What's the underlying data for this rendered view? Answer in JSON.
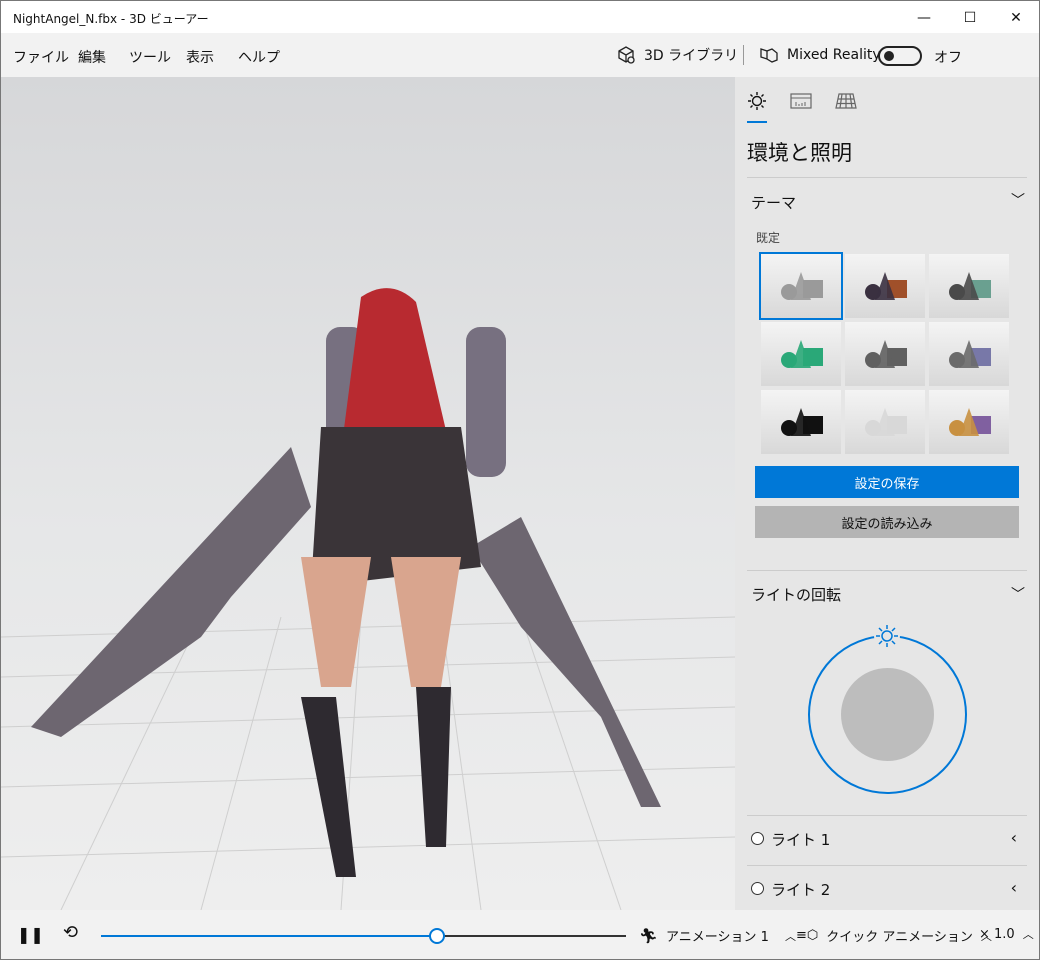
{
  "window": {
    "title": "NightAngel_N.fbx - 3D ビューアー",
    "minimize": "—",
    "maximize": "☐",
    "close": "✕"
  },
  "menu": [
    "ファイル",
    "編集",
    "ツール",
    "表示",
    "ヘルプ"
  ],
  "toolbar": {
    "library_label": "3D ライブラリ",
    "mixed_reality_label": "Mixed Reality",
    "toggle_state": "オフ",
    "toggle_on": false
  },
  "panel": {
    "tabs": [
      {
        "icon": "sun-icon",
        "active": true
      },
      {
        "icon": "stats-icon",
        "active": false
      },
      {
        "icon": "grid-icon",
        "active": false
      }
    ],
    "heading": "環境と照明",
    "theme": {
      "label": "テーマ",
      "default_label": "既定",
      "selected_index": 0,
      "swatches": [
        [
          "#9a9a9a",
          "#9a9a9a"
        ],
        [
          "#3a3040",
          "#a0502a"
        ],
        [
          "#4a4a4a",
          "#6aa090"
        ],
        [
          "#2aa878",
          "#2aa878"
        ],
        [
          "#606060",
          "#606060"
        ],
        [
          "#6a6a6a",
          "#7878a8"
        ],
        [
          "#111111",
          "#111111"
        ],
        [
          "#d8d8d8",
          "#d8d8d8"
        ],
        [
          "#c89040",
          "#8060a0"
        ]
      ]
    },
    "save_button": "設定の保存",
    "load_button": "設定の読み込み",
    "light_rotation": {
      "label": "ライトの回転"
    },
    "lights": [
      {
        "label": "ライト 1"
      },
      {
        "label": "ライト 2"
      }
    ]
  },
  "bottom": {
    "play_icon": "pause-icon",
    "loop_icon": "loop-icon",
    "progress": 0.64,
    "animation_label": "アニメーション 1",
    "quick_animation_label": "クイック アニメーション",
    "speed_label": "× 1.0"
  },
  "colors": {
    "accent": "#0078d7",
    "button_secondary": "#b4b4b4"
  }
}
